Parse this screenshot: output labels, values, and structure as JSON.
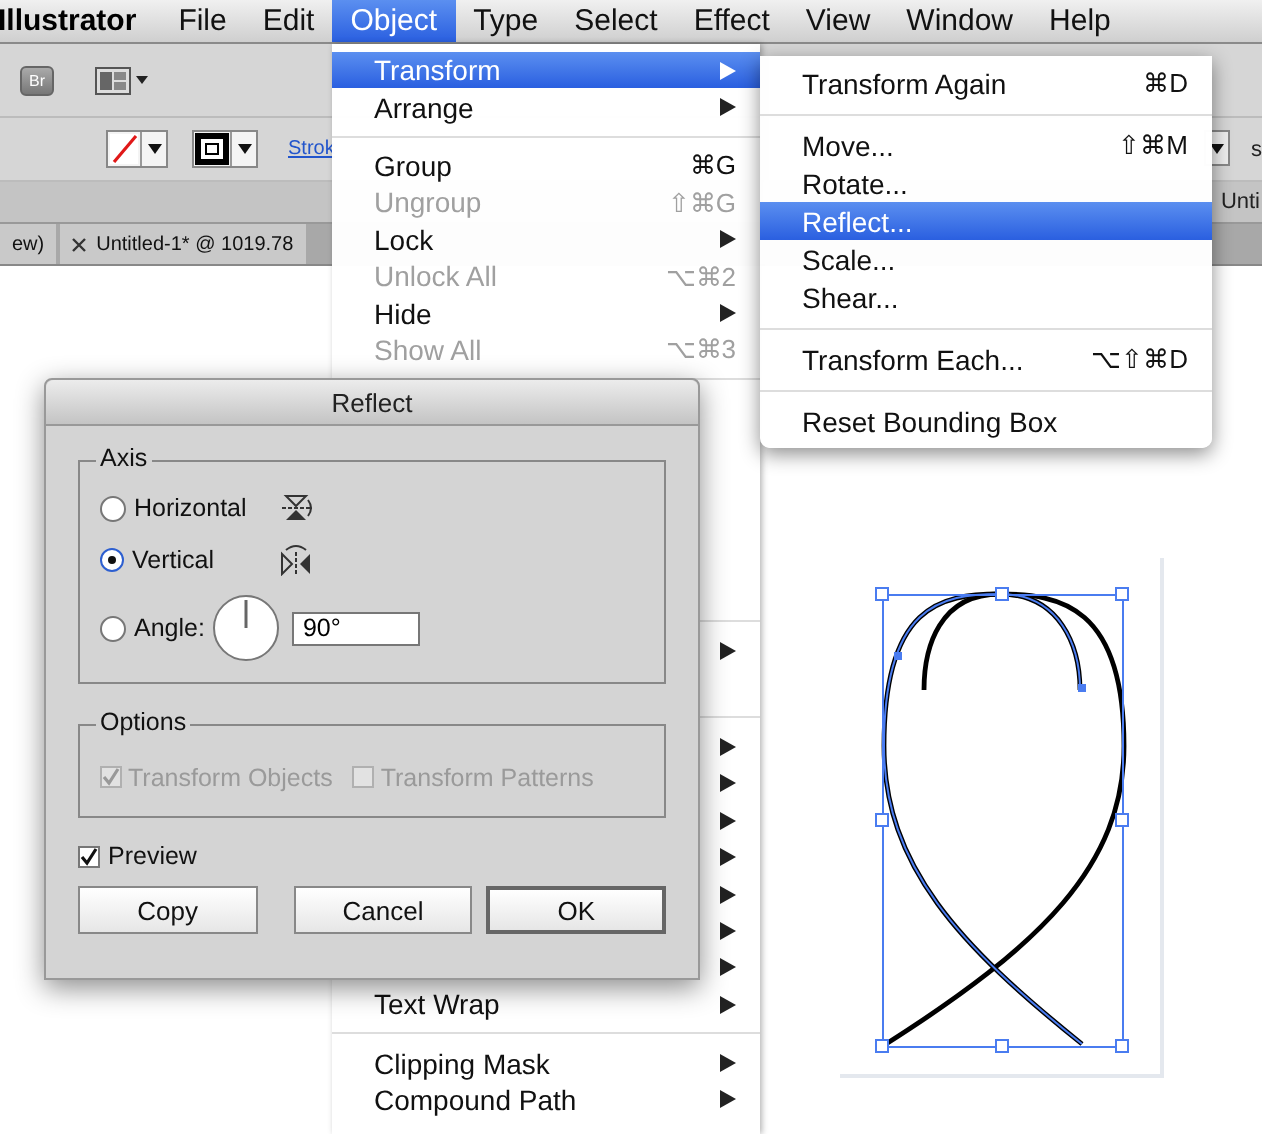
{
  "app": {
    "name": "Illustrator"
  },
  "menubar": [
    {
      "label": "File",
      "selected": false
    },
    {
      "label": "Edit",
      "selected": false
    },
    {
      "label": "Object",
      "selected": true
    },
    {
      "label": "Type",
      "selected": false
    },
    {
      "label": "Select",
      "selected": false
    },
    {
      "label": "Effect",
      "selected": false
    },
    {
      "label": "View",
      "selected": false
    },
    {
      "label": "Window",
      "selected": false
    },
    {
      "label": "Help",
      "selected": false
    }
  ],
  "control_bar": {
    "bridge_button": "Br",
    "stroke_link": "Strok",
    "cut_label": "s",
    "panel_tab": "Unti"
  },
  "document_tabs": [
    {
      "label": "ew)",
      "closable": false
    },
    {
      "label": "Untitled-1* @ 1019.78",
      "closable": true
    }
  ],
  "object_menu": {
    "items": [
      {
        "kind": "item",
        "label": "Transform",
        "submenu": true,
        "selected": true,
        "disabled": false
      },
      {
        "kind": "item",
        "label": "Arrange",
        "submenu": true,
        "selected": false,
        "disabled": false
      },
      {
        "kind": "separator"
      },
      {
        "kind": "item",
        "label": "Group",
        "shortcut": "⌘G",
        "submenu": false,
        "selected": false,
        "disabled": false
      },
      {
        "kind": "item",
        "label": "Ungroup",
        "shortcut": "⇧⌘G",
        "submenu": false,
        "selected": false,
        "disabled": true
      },
      {
        "kind": "item",
        "label": "Lock",
        "submenu": true,
        "selected": false,
        "disabled": false
      },
      {
        "kind": "item",
        "label": "Unlock All",
        "shortcut": "⌥⌘2",
        "submenu": false,
        "selected": false,
        "disabled": true
      },
      {
        "kind": "item",
        "label": "Hide",
        "submenu": true,
        "selected": false,
        "disabled": false
      },
      {
        "kind": "item",
        "label": "Show All",
        "shortcut": "⌥⌘3",
        "submenu": false,
        "selected": false,
        "disabled": true
      },
      {
        "kind": "separator"
      },
      {
        "kind": "item",
        "submenu": false,
        "selected": false
      },
      {
        "kind": "item",
        "submenu": false,
        "selected": false
      },
      {
        "kind": "item",
        "submenu": false,
        "selected": false
      },
      {
        "kind": "item",
        "submenu": false,
        "selected": false
      },
      {
        "kind": "item",
        "submenu": false,
        "selected": false
      },
      {
        "kind": "item",
        "submenu": false,
        "selected": false
      },
      {
        "kind": "separator"
      },
      {
        "kind": "item",
        "submenu": true,
        "selected": false,
        "disabled": false
      },
      {
        "kind": "item",
        "submenu": false,
        "selected": false
      },
      {
        "kind": "separator"
      },
      {
        "kind": "item",
        "submenu": true,
        "selected": false,
        "disabled": false
      },
      {
        "kind": "item",
        "submenu": true,
        "selected": false,
        "disabled": false
      },
      {
        "kind": "item",
        "submenu": true,
        "selected": false,
        "disabled": false
      },
      {
        "kind": "item",
        "submenu": true,
        "selected": false,
        "disabled": false
      },
      {
        "kind": "item",
        "submenu": true,
        "selected": false,
        "disabled": false
      },
      {
        "kind": "item",
        "submenu": true,
        "selected": false,
        "disabled": false
      },
      {
        "kind": "item",
        "submenu": true,
        "selected": false,
        "disabled": false
      },
      {
        "kind": "item",
        "label": "Text Wrap",
        "submenu": true,
        "selected": false,
        "disabled": false
      },
      {
        "kind": "separator"
      },
      {
        "kind": "item",
        "label": "Clipping Mask",
        "submenu": true,
        "selected": false,
        "disabled": false
      },
      {
        "kind": "item",
        "label": "Compound Path",
        "submenu": true,
        "selected": false,
        "disabled": false
      }
    ]
  },
  "transform_submenu": {
    "items": [
      {
        "kind": "item",
        "label": "Transform Again",
        "shortcut": "⌘D",
        "selected": false
      },
      {
        "kind": "separator"
      },
      {
        "kind": "item",
        "label": "Move...",
        "shortcut": "⇧⌘M",
        "selected": false
      },
      {
        "kind": "item",
        "label": "Rotate...",
        "selected": false
      },
      {
        "kind": "item",
        "label": "Reflect...",
        "selected": true
      },
      {
        "kind": "item",
        "label": "Scale...",
        "selected": false
      },
      {
        "kind": "item",
        "label": "Shear...",
        "selected": false
      },
      {
        "kind": "separator"
      },
      {
        "kind": "item",
        "label": "Transform Each...",
        "shortcut": "⌥⇧⌘D",
        "selected": false
      },
      {
        "kind": "separator"
      },
      {
        "kind": "item",
        "label": "Reset Bounding Box",
        "selected": false
      }
    ]
  },
  "reflect_dialog": {
    "title": "Reflect",
    "axis": {
      "legend": "Axis",
      "angle_value": "90°",
      "options": [
        {
          "label": "Horizontal",
          "kind": "horizontal",
          "selected": false
        },
        {
          "label": "Vertical",
          "kind": "vertical",
          "selected": true
        },
        {
          "label": "Angle:",
          "kind": "angle",
          "selected": false
        }
      ]
    },
    "options": {
      "legend": "Options",
      "checkboxes": [
        {
          "label": "Transform Objects",
          "checked": true,
          "disabled": true
        },
        {
          "label": "Transform Patterns",
          "checked": false,
          "disabled": true
        }
      ]
    },
    "preview": {
      "label": "Preview",
      "checked": true
    },
    "buttons": [
      {
        "label": "Copy",
        "default": false
      },
      {
        "label": "Cancel",
        "default": false
      },
      {
        "label": "OK",
        "default": true
      }
    ]
  }
}
